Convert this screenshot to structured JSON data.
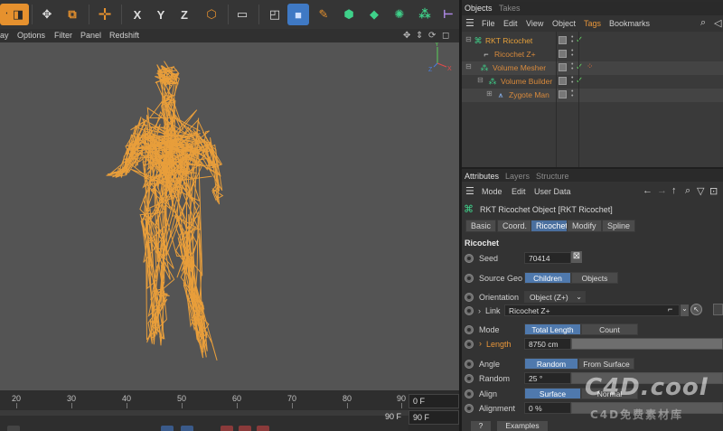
{
  "viewport_menu": [
    "ay",
    "Options",
    "Filter",
    "Panel",
    "Redshift"
  ],
  "toolbar": {
    "axis_x": "X",
    "axis_y": "Y",
    "axis_z": "Z",
    "icons": [
      "undo-icon",
      "render-region-icon",
      "move-icon",
      "object-icon",
      "cross-icon",
      "move-tool-icon",
      "axis-x-icon",
      "axis-y-icon",
      "axis-z-icon",
      "coordinate-icon",
      "render-icon",
      "cube-icon",
      "pen-icon",
      "deformer-icon",
      "generator-icon",
      "volume-icon",
      "mograph-icon",
      "camera-icon"
    ]
  },
  "timeline": {
    "ticks": [
      "20",
      "30",
      "40",
      "50",
      "60",
      "70",
      "80",
      "90"
    ],
    "start_frame": "0 F",
    "end_frame": "90 F",
    "current_end": "90 F"
  },
  "objects_panel": {
    "tabs": [
      "Objects",
      "Takes"
    ],
    "menu": [
      "File",
      "Edit",
      "View",
      "Object",
      "Tags",
      "Bookmarks"
    ],
    "items": [
      {
        "name": "RKT Ricochet",
        "indent": 0,
        "color": "#e6a03a"
      },
      {
        "name": "Ricochet Z+",
        "indent": 1,
        "color": "#d88a3c"
      },
      {
        "name": "Volume Mesher",
        "indent": 0,
        "color": "#d88a3c"
      },
      {
        "name": "Volume Builder",
        "indent": 1,
        "color": "#d88a3c"
      },
      {
        "name": "Zygote Man",
        "indent": 2,
        "color": "#d88a3c"
      }
    ]
  },
  "attributes_panel": {
    "tabs": [
      "Attributes",
      "Layers",
      "Structure"
    ],
    "menu": [
      "Mode",
      "Edit",
      "User Data"
    ],
    "title": "RKT Ricochet Object [RKT Ricochet]",
    "subtabs": [
      "Basic",
      "Coord.",
      "Ricochet",
      "Modify",
      "Spline"
    ],
    "active_subtab": "Ricochet",
    "section": "Ricochet",
    "seed_label": "Seed",
    "seed_value": "70414",
    "source_geo_label": "Source Geo",
    "source_geo_options": [
      "Children",
      "Objects"
    ],
    "orientation_label": "Orientation",
    "orientation_value": "Object (Z+)",
    "link_label": "Link",
    "link_value": "Ricochet Z+",
    "mode_label": "Mode",
    "mode_options": [
      "Total Length",
      "Count"
    ],
    "length_label": "Length",
    "length_value": "8750 cm",
    "angle_label": "Angle",
    "angle_options": [
      "Random",
      "From Surface"
    ],
    "random_label": "Random",
    "random_value": "25 °",
    "align_label": "Align",
    "align_options": [
      "Surface",
      "Normal"
    ],
    "alignment_label": "Alignment",
    "alignment_value": "0 %",
    "bottom_buttons": [
      "?",
      "Examples"
    ]
  },
  "watermark": {
    "main": "C4D.cool",
    "sub": "C4D免费素材库"
  }
}
